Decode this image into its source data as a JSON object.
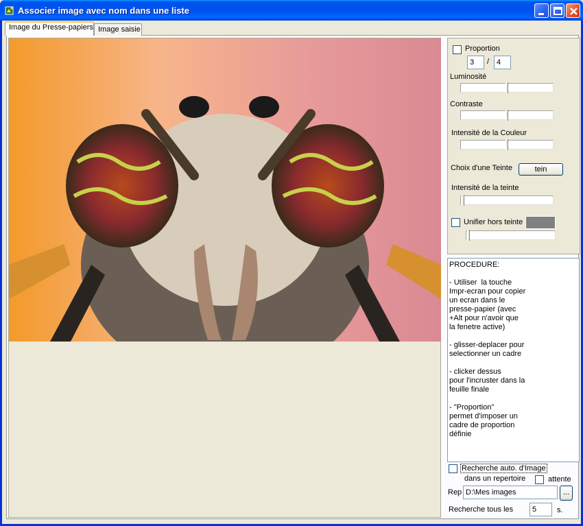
{
  "window": {
    "title": "Associer image avec nom dans une liste"
  },
  "tabs": [
    {
      "label": "Image du Presse-papiers"
    },
    {
      "label": "Image saisie"
    }
  ],
  "controls": {
    "proportion_label": "Proportion",
    "proportion_num": "3",
    "proportion_sep": "/",
    "proportion_den": "4",
    "luminosite_label": "Luminosité",
    "luminosite_level": 0.5,
    "contraste_label": "Contraste",
    "contraste_level": 0.5,
    "intensite_couleur_label": "Intensité de la Couleur",
    "intensite_couleur_level": 0.5,
    "choix_teinte_label": "Choix d'une Teinte",
    "teinte_button": "tein",
    "intensite_teinte_label": "Intensité de la teinte",
    "intensite_teinte_level": 0.0,
    "unifier_label": "Unifier hors teinte",
    "unifier_color": "#808080",
    "unifier_level": 0.0
  },
  "procedure": "PROCEDURE:\n\n- Utiliser  la touche\nImpr-ecran pour copier\nun ecran dans le\npresse-papier (avec\n+Alt pour n'avoir que\nla fenetre active)\n\n- glisser-deplacer pour\nselectionner un cadre\n\n- clicker dessus\npour l'incruster dans la\nfeuille finale\n\n- \"Proportion\"\npermet d'imposer un\ncadre de proportion\ndéfinie",
  "search": {
    "auto_label": "Recherche auto. d'Image",
    "dans_label": "dans un repertoire",
    "attente_label": "attente",
    "rep_label": "Rep",
    "rep_value": "D:\\Mes images",
    "browse_label": "...",
    "interval_label": "Recherche tous les",
    "interval_value": "5",
    "unit_label": "s."
  },
  "colors": {
    "title_blue": "#0054e3",
    "window_face": "#ece9d8",
    "close_red": "#e0512a"
  }
}
